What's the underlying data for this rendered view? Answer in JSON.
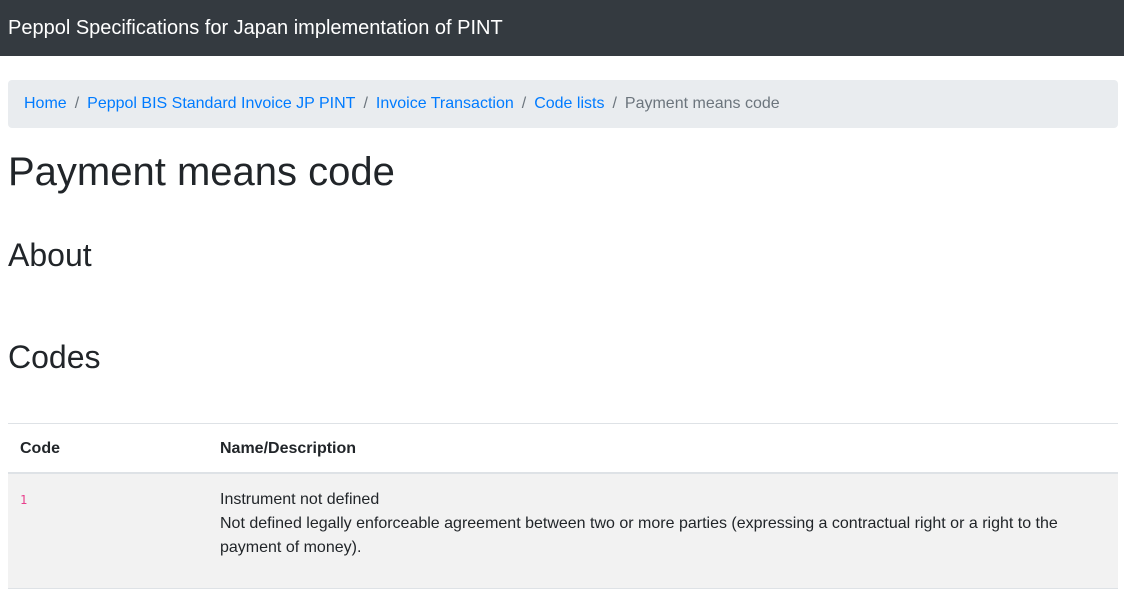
{
  "navbar": {
    "brand": "Peppol Specifications for Japan implementation of PINT"
  },
  "breadcrumb": {
    "items": [
      {
        "label": "Home"
      },
      {
        "label": "Peppol BIS Standard Invoice JP PINT"
      },
      {
        "label": "Invoice Transaction"
      },
      {
        "label": "Code lists"
      }
    ],
    "separator": "/",
    "current": "Payment means code"
  },
  "page": {
    "title": "Payment means code",
    "about_heading": "About",
    "codes_heading": "Codes"
  },
  "table": {
    "headers": {
      "code": "Code",
      "name": "Name/Description"
    },
    "rows": [
      {
        "code": "1",
        "name": "Instrument not defined",
        "description": "Not defined legally enforceable agreement between two or more parties (expressing a contractual right or a right to the payment of money)."
      }
    ]
  },
  "colors": {
    "navbar_bg": "#343a40",
    "link": "#007bff",
    "code": "#e83e8c",
    "breadcrumb_bg": "#e9ecef"
  }
}
